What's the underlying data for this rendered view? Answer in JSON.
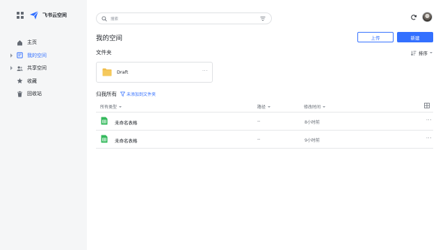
{
  "app": {
    "title": "飞书云空间"
  },
  "sidebar": {
    "items": [
      {
        "label": "主页",
        "icon": "home-icon",
        "active": false,
        "has_caret": false
      },
      {
        "label": "我的空间",
        "icon": "my-space-icon",
        "active": true,
        "has_caret": true
      },
      {
        "label": "共享空间",
        "icon": "shared-space-icon",
        "active": false,
        "has_caret": true
      },
      {
        "label": "收藏",
        "icon": "star-icon",
        "active": false,
        "has_caret": false
      },
      {
        "label": "回收站",
        "icon": "trash-icon",
        "active": false,
        "has_caret": false
      }
    ]
  },
  "search": {
    "placeholder": "搜索"
  },
  "header": {
    "page_title": "我的空间",
    "upload_label": "上传",
    "new_label": "新建"
  },
  "folders": {
    "section_title": "文件夹",
    "sort_label": "排序",
    "items": [
      {
        "name": "Draft",
        "more": "···"
      }
    ]
  },
  "owned": {
    "title": "归我所有",
    "filter_note": "未添加到文件夹",
    "columns": {
      "type": "所有类型",
      "path": "路径",
      "modified": "修改时间"
    },
    "rows": [
      {
        "name": "未命名表格",
        "path": "--",
        "modified": "8小时前",
        "more": "···"
      },
      {
        "name": "未命名表格",
        "path": "--",
        "modified": "9小时前",
        "more": "···"
      }
    ]
  },
  "colors": {
    "accent": "#3370ff",
    "sidebar_bg": "#f5f6f7",
    "folder": "#f0bd4a",
    "sheet": "#34b95c"
  }
}
